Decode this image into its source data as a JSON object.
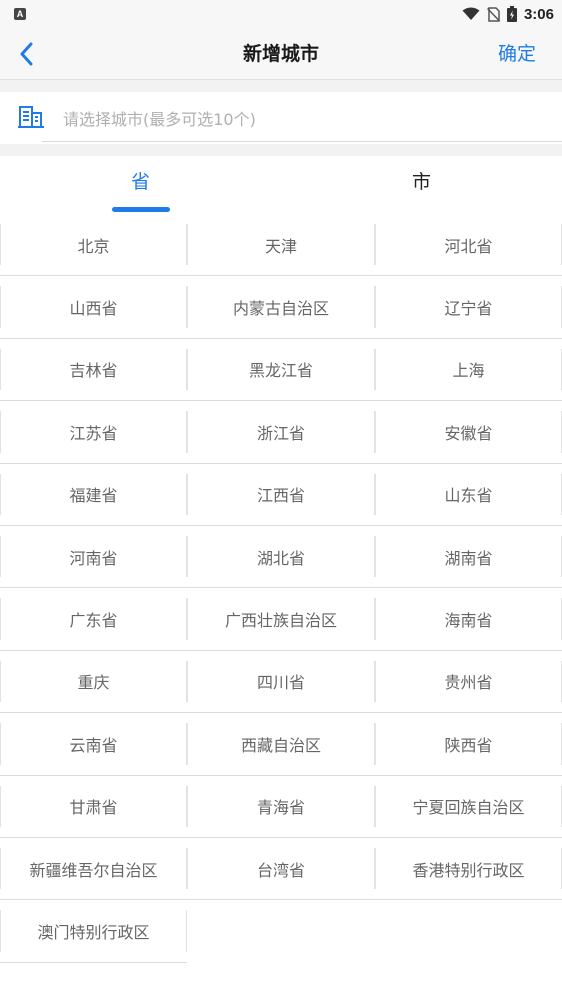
{
  "status_bar": {
    "time": "3:06",
    "left_badge": "A",
    "icons": [
      "wifi-icon",
      "no-sim-icon",
      "battery-icon"
    ]
  },
  "nav": {
    "title": "新增城市",
    "confirm_label": "确定",
    "back_icon": "chevron-left-icon"
  },
  "search": {
    "value": "",
    "placeholder": "请选择城市(最多可选10个)",
    "icon": "building-icon"
  },
  "tabs": [
    {
      "label": "省",
      "active": true
    },
    {
      "label": "市",
      "active": false
    }
  ],
  "provinces": [
    "北京",
    "天津",
    "河北省",
    "山西省",
    "内蒙古自治区",
    "辽宁省",
    "吉林省",
    "黑龙江省",
    "上海",
    "江苏省",
    "浙江省",
    "安徽省",
    "福建省",
    "江西省",
    "山东省",
    "河南省",
    "湖北省",
    "湖南省",
    "广东省",
    "广西壮族自治区",
    "海南省",
    "重庆",
    "四川省",
    "贵州省",
    "云南省",
    "西藏自治区",
    "陕西省",
    "甘肃省",
    "青海省",
    "宁夏回族自治区",
    "新疆维吾尔自治区",
    "台湾省",
    "香港特别行政区",
    "澳门特别行政区"
  ],
  "colors": {
    "accent": "#1f7be6",
    "text_muted": "#666666",
    "divider": "#dcdcdc"
  }
}
